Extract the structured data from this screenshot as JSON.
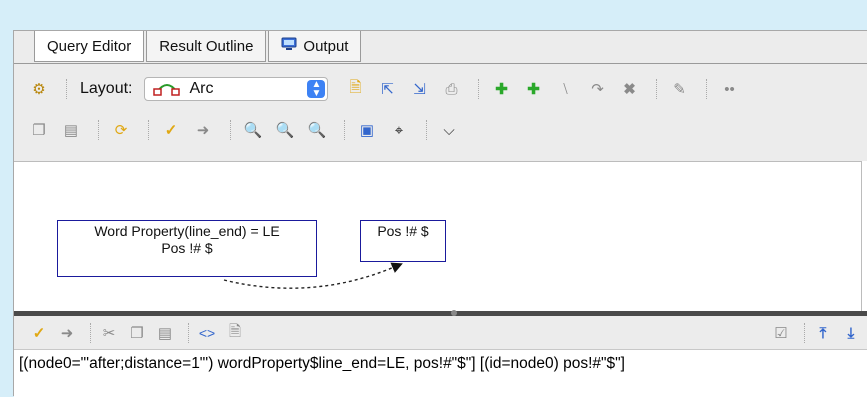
{
  "tabs": [
    {
      "label": "Query Editor",
      "active": true
    },
    {
      "label": "Result Outline",
      "active": false
    },
    {
      "label": "Output",
      "active": false,
      "icon": "monitor-icon"
    }
  ],
  "toolbar": {
    "layout_label": "Layout:",
    "layout_value": "Arc"
  },
  "graph": {
    "nodes": [
      {
        "line1": "Word Property(line_end) = LE",
        "line2": "Pos !# $"
      },
      {
        "line1": "Pos !# $",
        "line2": ""
      }
    ]
  },
  "query_text": "[(node0=\"'after;distance=1\"') wordProperty$line_end=LE, pos!#\"$\"] [(id=node0) pos!#\"$\"]",
  "colors": {
    "background": "#d6eef9",
    "node_border": "#1a1a9c",
    "combo_accent": "#3d82f4"
  }
}
